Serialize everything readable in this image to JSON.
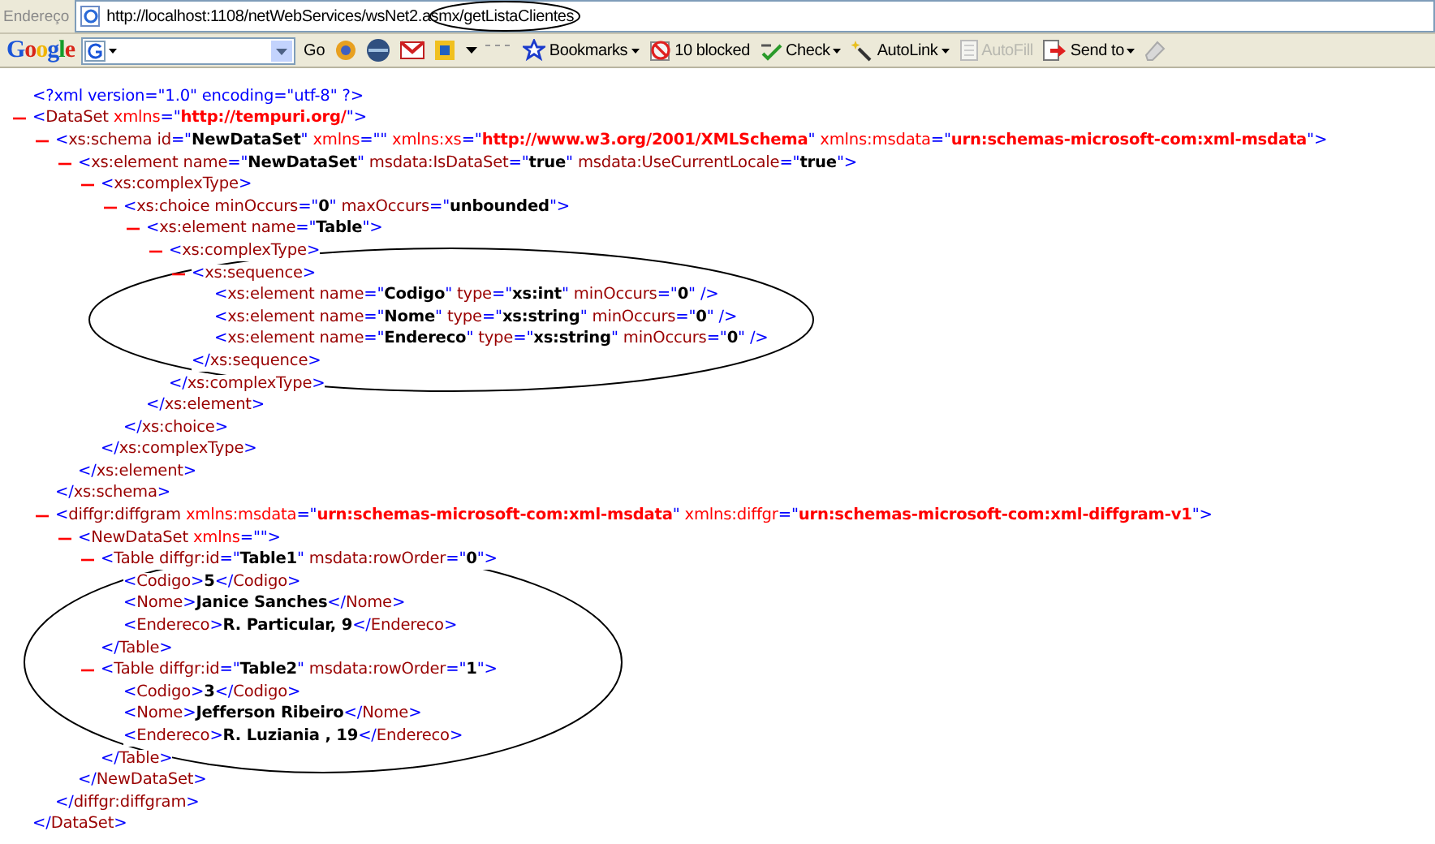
{
  "address_bar": {
    "label": "Endereço",
    "url": "http://localhost:1108/netWebServices/wsNet2.asmx/getListaClientes"
  },
  "toolbar": {
    "logo": "Google",
    "search_button": "Go",
    "items": [
      {
        "label": "Bookmarks",
        "kind": "bookmarks",
        "dropdown": true,
        "disabled": false
      },
      {
        "label": "10 blocked",
        "kind": "blocked",
        "dropdown": false,
        "disabled": false
      },
      {
        "label": "Check",
        "kind": "check",
        "dropdown": true,
        "disabled": false
      },
      {
        "label": "AutoLink",
        "kind": "autolink",
        "dropdown": true,
        "disabled": false
      },
      {
        "label": "AutoFill",
        "kind": "autofill",
        "dropdown": false,
        "disabled": true
      },
      {
        "label": "Send to",
        "kind": "sendto",
        "dropdown": true,
        "disabled": false
      }
    ]
  },
  "document": {
    "declaration": [
      {
        "kind": "pi",
        "text": "<?xml version=\"1.0\" encoding=\"utf-8\" ?>"
      }
    ],
    "root": {
      "expanded": true,
      "open": [
        {
          "kind": "mark",
          "text": "<"
        },
        {
          "kind": "tag",
          "text": "DataSet"
        },
        {
          "kind": "nsattr",
          "text": " xmlns"
        },
        {
          "kind": "mark",
          "text": "=\""
        },
        {
          "kind": "nsvalue",
          "text": "http://tempuri.org/"
        },
        {
          "kind": "mark",
          "text": "\">"
        }
      ],
      "close": [
        {
          "kind": "mark",
          "text": "</"
        },
        {
          "kind": "tag",
          "text": "DataSet"
        },
        {
          "kind": "mark",
          "text": ">"
        }
      ],
      "children": [
        {
          "expanded": true,
          "open": [
            {
              "kind": "mark",
              "text": "<"
            },
            {
              "kind": "tag",
              "text": "xs:schema"
            },
            {
              "kind": "attr",
              "text": " id"
            },
            {
              "kind": "mark",
              "text": "=\""
            },
            {
              "kind": "value",
              "text": "NewDataSet"
            },
            {
              "kind": "mark",
              "text": "\""
            },
            {
              "kind": "nsattr",
              "text": " xmlns"
            },
            {
              "kind": "mark",
              "text": "=\"\""
            },
            {
              "kind": "nsattr",
              "text": " xmlns:xs"
            },
            {
              "kind": "mark",
              "text": "=\""
            },
            {
              "kind": "nsvalue",
              "text": "http://www.w3.org/2001/XMLSchema"
            },
            {
              "kind": "mark",
              "text": "\""
            },
            {
              "kind": "nsattr",
              "text": " xmlns:msdata"
            },
            {
              "kind": "mark",
              "text": "=\""
            },
            {
              "kind": "nsvalue",
              "text": "urn:schemas-microsoft-com:xml-msdata"
            },
            {
              "kind": "mark",
              "text": "\">"
            }
          ],
          "close": [
            {
              "kind": "mark",
              "text": "</"
            },
            {
              "kind": "tag",
              "text": "xs:schema"
            },
            {
              "kind": "mark",
              "text": ">"
            }
          ],
          "children": [
            {
              "expanded": true,
              "open": [
                {
                  "kind": "mark",
                  "text": "<"
                },
                {
                  "kind": "tag",
                  "text": "xs:element"
                },
                {
                  "kind": "attr",
                  "text": " name"
                },
                {
                  "kind": "mark",
                  "text": "=\""
                },
                {
                  "kind": "value",
                  "text": "NewDataSet"
                },
                {
                  "kind": "mark",
                  "text": "\""
                },
                {
                  "kind": "attr",
                  "text": " msdata:IsDataSet"
                },
                {
                  "kind": "mark",
                  "text": "=\""
                },
                {
                  "kind": "value",
                  "text": "true"
                },
                {
                  "kind": "mark",
                  "text": "\""
                },
                {
                  "kind": "attr",
                  "text": " msdata:UseCurrentLocale"
                },
                {
                  "kind": "mark",
                  "text": "=\""
                },
                {
                  "kind": "value",
                  "text": "true"
                },
                {
                  "kind": "mark",
                  "text": "\">"
                }
              ],
              "close": [
                {
                  "kind": "mark",
                  "text": "</"
                },
                {
                  "kind": "tag",
                  "text": "xs:element"
                },
                {
                  "kind": "mark",
                  "text": ">"
                }
              ],
              "children": [
                {
                  "expanded": true,
                  "open": [
                    {
                      "kind": "mark",
                      "text": "<"
                    },
                    {
                      "kind": "tag",
                      "text": "xs:complexType"
                    },
                    {
                      "kind": "mark",
                      "text": ">"
                    }
                  ],
                  "close": [
                    {
                      "kind": "mark",
                      "text": "</"
                    },
                    {
                      "kind": "tag",
                      "text": "xs:complexType"
                    },
                    {
                      "kind": "mark",
                      "text": ">"
                    }
                  ],
                  "children": [
                    {
                      "expanded": true,
                      "open": [
                        {
                          "kind": "mark",
                          "text": "<"
                        },
                        {
                          "kind": "tag",
                          "text": "xs:choice"
                        },
                        {
                          "kind": "attr",
                          "text": " minOccurs"
                        },
                        {
                          "kind": "mark",
                          "text": "=\""
                        },
                        {
                          "kind": "value",
                          "text": "0"
                        },
                        {
                          "kind": "mark",
                          "text": "\""
                        },
                        {
                          "kind": "attr",
                          "text": " maxOccurs"
                        },
                        {
                          "kind": "mark",
                          "text": "=\""
                        },
                        {
                          "kind": "value",
                          "text": "unbounded"
                        },
                        {
                          "kind": "mark",
                          "text": "\">"
                        }
                      ],
                      "close": [
                        {
                          "kind": "mark",
                          "text": "</"
                        },
                        {
                          "kind": "tag",
                          "text": "xs:choice"
                        },
                        {
                          "kind": "mark",
                          "text": ">"
                        }
                      ],
                      "children": [
                        {
                          "expanded": true,
                          "open": [
                            {
                              "kind": "mark",
                              "text": "<"
                            },
                            {
                              "kind": "tag",
                              "text": "xs:element"
                            },
                            {
                              "kind": "attr",
                              "text": " name"
                            },
                            {
                              "kind": "mark",
                              "text": "=\""
                            },
                            {
                              "kind": "value",
                              "text": "Table"
                            },
                            {
                              "kind": "mark",
                              "text": "\">"
                            }
                          ],
                          "close": [
                            {
                              "kind": "mark",
                              "text": "</"
                            },
                            {
                              "kind": "tag",
                              "text": "xs:element"
                            },
                            {
                              "kind": "mark",
                              "text": ">"
                            }
                          ],
                          "children": [
                            {
                              "expanded": true,
                              "open": [
                                {
                                  "kind": "mark",
                                  "text": "<"
                                },
                                {
                                  "kind": "tag",
                                  "text": "xs:complexType"
                                },
                                {
                                  "kind": "mark",
                                  "text": ">"
                                }
                              ],
                              "close": [
                                {
                                  "kind": "mark",
                                  "text": "</"
                                },
                                {
                                  "kind": "tag",
                                  "text": "xs:complexType"
                                },
                                {
                                  "kind": "mark",
                                  "text": ">"
                                }
                              ],
                              "children": [
                                {
                                  "expanded": true,
                                  "open": [
                                    {
                                      "kind": "mark",
                                      "text": "<"
                                    },
                                    {
                                      "kind": "tag",
                                      "text": "xs:sequence"
                                    },
                                    {
                                      "kind": "mark",
                                      "text": ">"
                                    }
                                  ],
                                  "close": [
                                    {
                                      "kind": "mark",
                                      "text": "</"
                                    },
                                    {
                                      "kind": "tag",
                                      "text": "xs:sequence"
                                    },
                                    {
                                      "kind": "mark",
                                      "text": ">"
                                    }
                                  ],
                                  "children": [
                                    {
                                      "open": [
                                        {
                                          "kind": "mark",
                                          "text": "<"
                                        },
                                        {
                                          "kind": "tag",
                                          "text": "xs:element"
                                        },
                                        {
                                          "kind": "attr",
                                          "text": " name"
                                        },
                                        {
                                          "kind": "mark",
                                          "text": "=\""
                                        },
                                        {
                                          "kind": "value",
                                          "text": "Codigo"
                                        },
                                        {
                                          "kind": "mark",
                                          "text": "\""
                                        },
                                        {
                                          "kind": "attr",
                                          "text": " type"
                                        },
                                        {
                                          "kind": "mark",
                                          "text": "=\""
                                        },
                                        {
                                          "kind": "value",
                                          "text": "xs:int"
                                        },
                                        {
                                          "kind": "mark",
                                          "text": "\""
                                        },
                                        {
                                          "kind": "attr",
                                          "text": " minOccurs"
                                        },
                                        {
                                          "kind": "mark",
                                          "text": "=\""
                                        },
                                        {
                                          "kind": "value",
                                          "text": "0"
                                        },
                                        {
                                          "kind": "mark",
                                          "text": "\" />"
                                        }
                                      ]
                                    },
                                    {
                                      "open": [
                                        {
                                          "kind": "mark",
                                          "text": "<"
                                        },
                                        {
                                          "kind": "tag",
                                          "text": "xs:element"
                                        },
                                        {
                                          "kind": "attr",
                                          "text": " name"
                                        },
                                        {
                                          "kind": "mark",
                                          "text": "=\""
                                        },
                                        {
                                          "kind": "value",
                                          "text": "Nome"
                                        },
                                        {
                                          "kind": "mark",
                                          "text": "\""
                                        },
                                        {
                                          "kind": "attr",
                                          "text": " type"
                                        },
                                        {
                                          "kind": "mark",
                                          "text": "=\""
                                        },
                                        {
                                          "kind": "value",
                                          "text": "xs:string"
                                        },
                                        {
                                          "kind": "mark",
                                          "text": "\""
                                        },
                                        {
                                          "kind": "attr",
                                          "text": " minOccurs"
                                        },
                                        {
                                          "kind": "mark",
                                          "text": "=\""
                                        },
                                        {
                                          "kind": "value",
                                          "text": "0"
                                        },
                                        {
                                          "kind": "mark",
                                          "text": "\" />"
                                        }
                                      ]
                                    },
                                    {
                                      "open": [
                                        {
                                          "kind": "mark",
                                          "text": "<"
                                        },
                                        {
                                          "kind": "tag",
                                          "text": "xs:element"
                                        },
                                        {
                                          "kind": "attr",
                                          "text": " name"
                                        },
                                        {
                                          "kind": "mark",
                                          "text": "=\""
                                        },
                                        {
                                          "kind": "value",
                                          "text": "Endereco"
                                        },
                                        {
                                          "kind": "mark",
                                          "text": "\""
                                        },
                                        {
                                          "kind": "attr",
                                          "text": " type"
                                        },
                                        {
                                          "kind": "mark",
                                          "text": "=\""
                                        },
                                        {
                                          "kind": "value",
                                          "text": "xs:string"
                                        },
                                        {
                                          "kind": "mark",
                                          "text": "\""
                                        },
                                        {
                                          "kind": "attr",
                                          "text": " minOccurs"
                                        },
                                        {
                                          "kind": "mark",
                                          "text": "=\""
                                        },
                                        {
                                          "kind": "value",
                                          "text": "0"
                                        },
                                        {
                                          "kind": "mark",
                                          "text": "\" />"
                                        }
                                      ]
                                    }
                                  ]
                                }
                              ]
                            }
                          ]
                        }
                      ]
                    }
                  ]
                }
              ]
            }
          ]
        },
        {
          "expanded": true,
          "open": [
            {
              "kind": "mark",
              "text": "<"
            },
            {
              "kind": "tag",
              "text": "diffgr:diffgram"
            },
            {
              "kind": "nsattr",
              "text": " xmlns:msdata"
            },
            {
              "kind": "mark",
              "text": "=\""
            },
            {
              "kind": "nsvalue",
              "text": "urn:schemas-microsoft-com:xml-msdata"
            },
            {
              "kind": "mark",
              "text": "\""
            },
            {
              "kind": "nsattr",
              "text": " xmlns:diffgr"
            },
            {
              "kind": "mark",
              "text": "=\""
            },
            {
              "kind": "nsvalue",
              "text": "urn:schemas-microsoft-com:xml-diffgram-v1"
            },
            {
              "kind": "mark",
              "text": "\">"
            }
          ],
          "close": [
            {
              "kind": "mark",
              "text": "</"
            },
            {
              "kind": "tag",
              "text": "diffgr:diffgram"
            },
            {
              "kind": "mark",
              "text": ">"
            }
          ],
          "children": [
            {
              "expanded": true,
              "open": [
                {
                  "kind": "mark",
                  "text": "<"
                },
                {
                  "kind": "tag",
                  "text": "NewDataSet"
                },
                {
                  "kind": "nsattr",
                  "text": " xmlns"
                },
                {
                  "kind": "mark",
                  "text": "=\"\">"
                }
              ],
              "close": [
                {
                  "kind": "mark",
                  "text": "</"
                },
                {
                  "kind": "tag",
                  "text": "NewDataSet"
                },
                {
                  "kind": "mark",
                  "text": ">"
                }
              ],
              "children": [
                {
                  "expanded": true,
                  "open": [
                    {
                      "kind": "mark",
                      "text": "<"
                    },
                    {
                      "kind": "tag",
                      "text": "Table"
                    },
                    {
                      "kind": "attr",
                      "text": " diffgr:id"
                    },
                    {
                      "kind": "mark",
                      "text": "=\""
                    },
                    {
                      "kind": "value",
                      "text": "Table1"
                    },
                    {
                      "kind": "mark",
                      "text": "\""
                    },
                    {
                      "kind": "attr",
                      "text": " msdata:rowOrder"
                    },
                    {
                      "kind": "mark",
                      "text": "=\""
                    },
                    {
                      "kind": "value",
                      "text": "0"
                    },
                    {
                      "kind": "mark",
                      "text": "\">"
                    }
                  ],
                  "close": [
                    {
                      "kind": "mark",
                      "text": "</"
                    },
                    {
                      "kind": "tag",
                      "text": "Table"
                    },
                    {
                      "kind": "mark",
                      "text": ">"
                    }
                  ],
                  "children": [
                    {
                      "open": [
                        {
                          "kind": "mark",
                          "text": "<"
                        },
                        {
                          "kind": "tag",
                          "text": "Codigo"
                        },
                        {
                          "kind": "mark",
                          "text": ">"
                        },
                        {
                          "kind": "text",
                          "text": "5"
                        },
                        {
                          "kind": "mark",
                          "text": "</"
                        },
                        {
                          "kind": "tag",
                          "text": "Codigo"
                        },
                        {
                          "kind": "mark",
                          "text": ">"
                        }
                      ]
                    },
                    {
                      "open": [
                        {
                          "kind": "mark",
                          "text": "<"
                        },
                        {
                          "kind": "tag",
                          "text": "Nome"
                        },
                        {
                          "kind": "mark",
                          "text": ">"
                        },
                        {
                          "kind": "text",
                          "text": "Janice Sanches"
                        },
                        {
                          "kind": "mark",
                          "text": "</"
                        },
                        {
                          "kind": "tag",
                          "text": "Nome"
                        },
                        {
                          "kind": "mark",
                          "text": ">"
                        }
                      ]
                    },
                    {
                      "open": [
                        {
                          "kind": "mark",
                          "text": "<"
                        },
                        {
                          "kind": "tag",
                          "text": "Endereco"
                        },
                        {
                          "kind": "mark",
                          "text": ">"
                        },
                        {
                          "kind": "text",
                          "text": "R. Particular, 9"
                        },
                        {
                          "kind": "mark",
                          "text": "</"
                        },
                        {
                          "kind": "tag",
                          "text": "Endereco"
                        },
                        {
                          "kind": "mark",
                          "text": ">"
                        }
                      ]
                    }
                  ]
                },
                {
                  "expanded": true,
                  "open": [
                    {
                      "kind": "mark",
                      "text": "<"
                    },
                    {
                      "kind": "tag",
                      "text": "Table"
                    },
                    {
                      "kind": "attr",
                      "text": " diffgr:id"
                    },
                    {
                      "kind": "mark",
                      "text": "=\""
                    },
                    {
                      "kind": "value",
                      "text": "Table2"
                    },
                    {
                      "kind": "mark",
                      "text": "\""
                    },
                    {
                      "kind": "attr",
                      "text": " msdata:rowOrder"
                    },
                    {
                      "kind": "mark",
                      "text": "=\""
                    },
                    {
                      "kind": "value",
                      "text": "1"
                    },
                    {
                      "kind": "mark",
                      "text": "\">"
                    }
                  ],
                  "close": [
                    {
                      "kind": "mark",
                      "text": "</"
                    },
                    {
                      "kind": "tag",
                      "text": "Table"
                    },
                    {
                      "kind": "mark",
                      "text": ">"
                    }
                  ],
                  "children": [
                    {
                      "open": [
                        {
                          "kind": "mark",
                          "text": "<"
                        },
                        {
                          "kind": "tag",
                          "text": "Codigo"
                        },
                        {
                          "kind": "mark",
                          "text": ">"
                        },
                        {
                          "kind": "text",
                          "text": "3"
                        },
                        {
                          "kind": "mark",
                          "text": "</"
                        },
                        {
                          "kind": "tag",
                          "text": "Codigo"
                        },
                        {
                          "kind": "mark",
                          "text": ">"
                        }
                      ]
                    },
                    {
                      "open": [
                        {
                          "kind": "mark",
                          "text": "<"
                        },
                        {
                          "kind": "tag",
                          "text": "Nome"
                        },
                        {
                          "kind": "mark",
                          "text": ">"
                        },
                        {
                          "kind": "text",
                          "text": "Jefferson Ribeiro"
                        },
                        {
                          "kind": "mark",
                          "text": "</"
                        },
                        {
                          "kind": "tag",
                          "text": "Nome"
                        },
                        {
                          "kind": "mark",
                          "text": ">"
                        }
                      ]
                    },
                    {
                      "open": [
                        {
                          "kind": "mark",
                          "text": "<"
                        },
                        {
                          "kind": "tag",
                          "text": "Endereco"
                        },
                        {
                          "kind": "mark",
                          "text": ">"
                        },
                        {
                          "kind": "text",
                          "text": "R. Luziania , 19"
                        },
                        {
                          "kind": "mark",
                          "text": "</"
                        },
                        {
                          "kind": "tag",
                          "text": "Endereco"
                        },
                        {
                          "kind": "mark",
                          "text": ">"
                        }
                      ]
                    }
                  ]
                }
              ]
            }
          ]
        }
      ]
    }
  }
}
